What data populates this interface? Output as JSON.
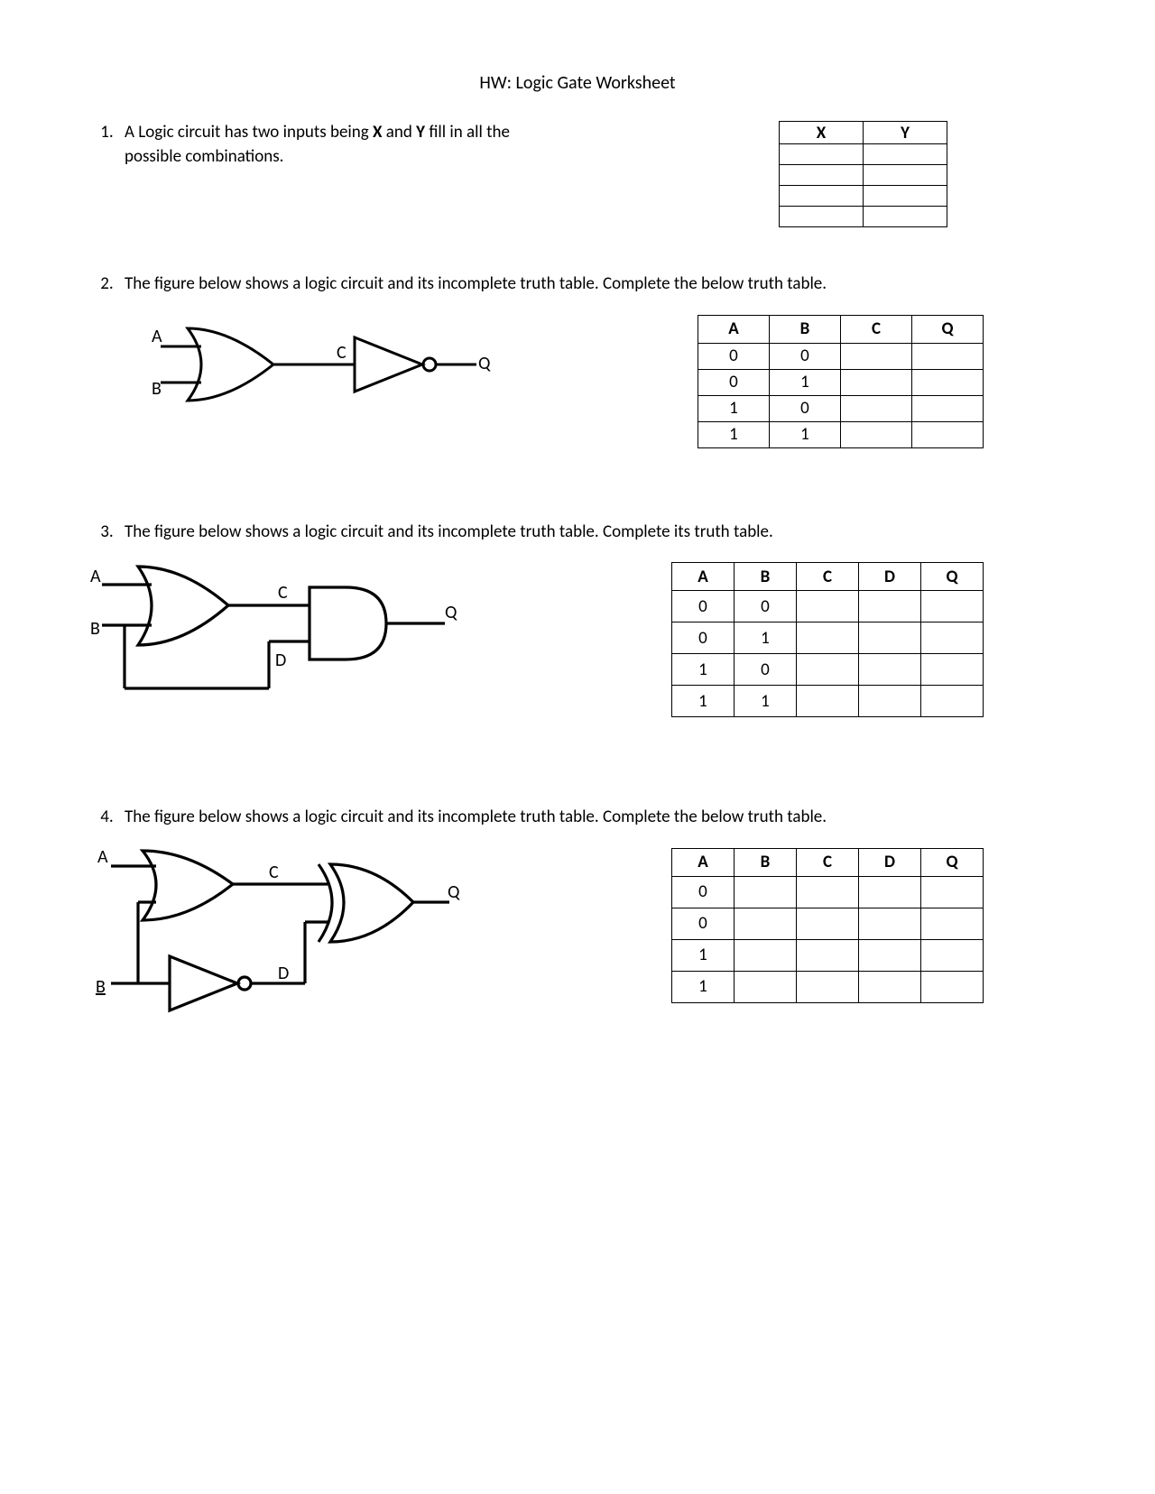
{
  "title": "HW: Logic Gate Worksheet",
  "q1": {
    "text_a": "A Logic circuit has two inputs being ",
    "bold_x": "X",
    "mid": " and ",
    "bold_y": "Y",
    "text_b": " fill in all the possible combinations.",
    "headers": [
      "X",
      "Y"
    ],
    "rows": [
      [
        "",
        ""
      ],
      [
        "",
        ""
      ],
      [
        "",
        ""
      ],
      [
        "",
        ""
      ]
    ]
  },
  "q2": {
    "text": "The figure below shows a logic circuit and its incomplete truth table. Complete the below truth table.",
    "labels": {
      "A": "A",
      "B": "B",
      "C": "C",
      "Q": "Q"
    },
    "headers": [
      "A",
      "B",
      "C",
      "Q"
    ],
    "rows": [
      [
        "0",
        "0",
        "",
        ""
      ],
      [
        "0",
        "1",
        "",
        ""
      ],
      [
        "1",
        "0",
        "",
        ""
      ],
      [
        "1",
        "1",
        "",
        ""
      ]
    ]
  },
  "q3": {
    "text": "The figure below shows a logic circuit and its incomplete truth table. Complete its truth table.",
    "labels": {
      "A": "A",
      "B": "B",
      "C": "C",
      "D": "D",
      "Q": "Q"
    },
    "headers": [
      "A",
      "B",
      "C",
      "D",
      "Q"
    ],
    "rows": [
      [
        "0",
        "0",
        "",
        "",
        ""
      ],
      [
        "0",
        "1",
        "",
        "",
        ""
      ],
      [
        "1",
        "0",
        "",
        "",
        ""
      ],
      [
        "1",
        "1",
        "",
        "",
        ""
      ]
    ]
  },
  "q4": {
    "text": "The figure below shows a logic circuit and its incomplete truth table. Complete the below truth table.",
    "labels": {
      "A": "A",
      "B": "B",
      "C": "C",
      "D": "D",
      "Q": "Q"
    },
    "headers": [
      "A",
      "B",
      "C",
      "D",
      "Q"
    ],
    "rows": [
      [
        "0",
        "",
        "",
        "",
        ""
      ],
      [
        "0",
        "",
        "",
        "",
        ""
      ],
      [
        "1",
        "",
        "",
        "",
        ""
      ],
      [
        "1",
        "",
        "",
        "",
        ""
      ]
    ]
  }
}
